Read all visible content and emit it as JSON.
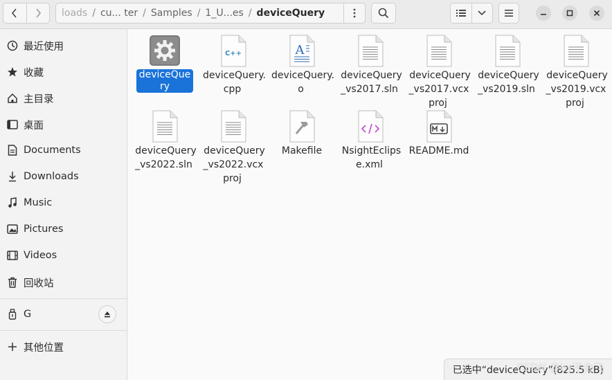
{
  "header": {
    "breadcrumbs": [
      "loads",
      "cu... ter",
      "Samples",
      "1_U...es",
      "deviceQuery"
    ],
    "separator": "/"
  },
  "sidebar": {
    "items": [
      {
        "label": "最近使用",
        "icon": "clock-icon"
      },
      {
        "label": "收藏",
        "icon": "star-icon"
      },
      {
        "label": "主目录",
        "icon": "home-icon"
      },
      {
        "label": "桌面",
        "icon": "desktop-icon"
      },
      {
        "label": "Documents",
        "icon": "document-icon"
      },
      {
        "label": "Downloads",
        "icon": "download-icon"
      },
      {
        "label": "Music",
        "icon": "music-icon"
      },
      {
        "label": "Pictures",
        "icon": "picture-icon"
      },
      {
        "label": "Videos",
        "icon": "video-icon"
      },
      {
        "label": "回收站",
        "icon": "trash-icon"
      }
    ],
    "drive": {
      "label": "G",
      "icon": "usb-drive-icon"
    },
    "other": {
      "label": "其他位置",
      "icon": "plus-icon"
    }
  },
  "files": [
    {
      "name": "deviceQuery",
      "icon": "executable-gear-icon",
      "selected": true
    },
    {
      "name": "deviceQuery.cpp",
      "icon": "cpp-file-icon"
    },
    {
      "name": "deviceQuery.o",
      "icon": "object-file-icon"
    },
    {
      "name": "deviceQuery_vs2017.sln",
      "icon": "text-file-icon"
    },
    {
      "name": "deviceQuery_vs2017.vcxproj",
      "icon": "text-file-icon"
    },
    {
      "name": "deviceQuery_vs2019.sln",
      "icon": "text-file-icon"
    },
    {
      "name": "deviceQuery_vs2019.vcxproj",
      "icon": "text-file-icon"
    },
    {
      "name": "deviceQuery_vs2022.sln",
      "icon": "text-file-icon"
    },
    {
      "name": "deviceQuery_vs2022.vcxproj",
      "icon": "text-file-icon"
    },
    {
      "name": "Makefile",
      "icon": "makefile-icon"
    },
    {
      "name": "NsightEclipse.xml",
      "icon": "xml-file-icon"
    },
    {
      "name": "README.md",
      "icon": "markdown-file-icon"
    }
  ],
  "status": {
    "text": "已选中“deviceQuery”(825.5 kB)"
  },
  "watermark": "CSDN @by不会飞"
}
